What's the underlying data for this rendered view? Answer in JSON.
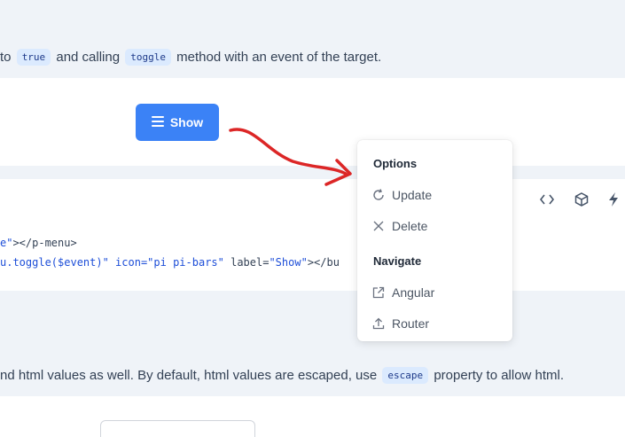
{
  "intro": {
    "part1": "to",
    "chip1": "true",
    "part2": "and calling",
    "chip2": "toggle",
    "part3": "method with an event of the target."
  },
  "demo": {
    "show_label": "Show"
  },
  "code": {
    "line1_a": "e\"",
    "line1_b": "></p-menu>",
    "line2_a": "u.toggle($event)\" icon=",
    "line2_b": "\"pi pi-bars\"",
    "line2_c": " label=",
    "line2_d": "\"Show\"",
    "line2_e": "></bu"
  },
  "toolbar": {
    "icons": [
      "code-icon",
      "box-icon",
      "bolt-icon"
    ]
  },
  "menu": {
    "group1": "Options",
    "item_update": "Update",
    "item_delete": "Delete",
    "group2": "Navigate",
    "item_angular": "Angular",
    "item_router": "Router"
  },
  "escape_note": {
    "part1": "nd html values as well. By default, html values are escaped, use",
    "chip": "escape",
    "part2": "property to allow html."
  },
  "colors": {
    "primary": "#3b82f6",
    "annotation_arrow": "#dc2626",
    "chip_bg": "#dbeafe"
  }
}
